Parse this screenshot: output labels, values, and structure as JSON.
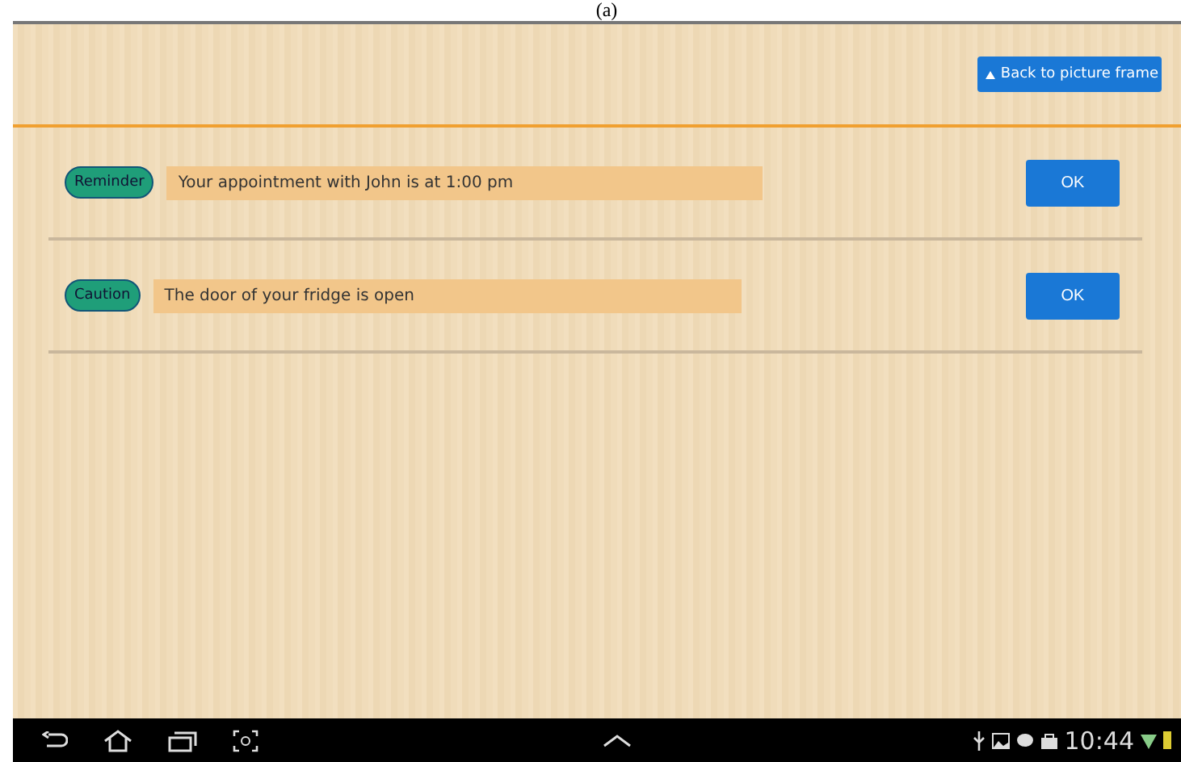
{
  "caption": "(a)",
  "header": {
    "back_button": "Back to picture frame"
  },
  "notifications": [
    {
      "tag": "Reminder",
      "message": "Your appointment with John is at 1:00 pm",
      "button": "OK"
    },
    {
      "tag": "Caution",
      "message": "The door of your fridge is open",
      "button": "OK"
    }
  ],
  "status_bar": {
    "time": "10:44"
  }
}
